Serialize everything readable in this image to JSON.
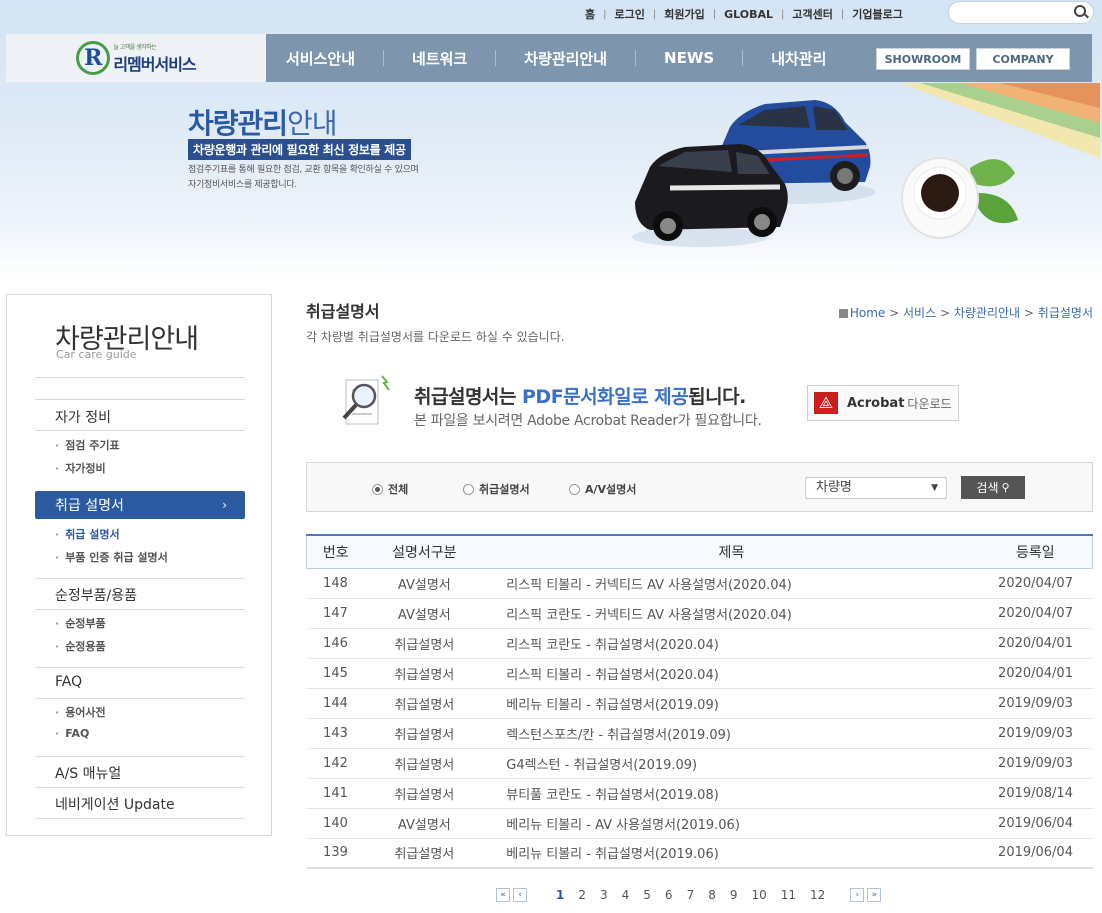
{
  "util": {
    "links": [
      "홈",
      "로그인",
      "회원가입",
      "GLOBAL",
      "고객센터",
      "기업블로그"
    ]
  },
  "nav": {
    "logo_small": "늘 고객을 생각하는",
    "logo_main": "리멤버서비스",
    "logo_letter": "R",
    "menu": [
      "서비스안내",
      "네트워크",
      "차량관리안내",
      "NEWS",
      "내차관리"
    ],
    "buttons": [
      "SHOWROOM",
      "COMPANY"
    ]
  },
  "banner": {
    "title_strong": "차량관리",
    "title_rest": "안내",
    "subtitle": "차량운행과 관리에 필요한 최신 정보를 제공",
    "desc_line1": "점검주기표를 통해 필요한 점검, 교환 항목을 확인하실 수 있으며",
    "desc_line2": "자기정비서비스를 제공합니다."
  },
  "sidebar": {
    "title": "차량관리안내",
    "subtitle": "Car care guide",
    "sections": {
      "self": "자가 정비",
      "self_links": [
        "점검 주기표",
        "자가정비"
      ],
      "manual": "취급 설명서",
      "manual_links": [
        "취급 설명서",
        "부품 인증 취급 설명서"
      ],
      "parts": "순정부품/용품",
      "parts_links": [
        "순정부품",
        "순정용품"
      ],
      "faq": "FAQ",
      "faq_links": [
        "용어사전",
        "FAQ"
      ],
      "as": "A/S 매뉴얼",
      "navi": "네비게이션 Update"
    }
  },
  "main": {
    "title": "취급설명서",
    "desc": "각 차량별 취급설명서를 다운로드 하실 수 있습니다.",
    "breadcrumb": [
      "Home",
      "서비스",
      "차량관리안내",
      "취급설명서"
    ],
    "pdf_title_a": "취급설명서는 ",
    "pdf_title_b": "PDF문서화일로 제공",
    "pdf_title_c": "됩니다.",
    "pdf_sub": "본 파일을 보시려면 Adobe Acrobat Reader가 필요합니다.",
    "acrobat_label": "Acrobat",
    "acrobat_download": "다운로드"
  },
  "filter": {
    "radios": [
      "전체",
      "취급설명서",
      "A/V설명서"
    ],
    "select_value": "차량명",
    "search_label": "검색"
  },
  "table": {
    "headers": [
      "번호",
      "설명서구분",
      "제목",
      "등록일"
    ],
    "rows": [
      [
        "148",
        "AV설명서",
        "리스픽 티볼리 - 커넥티드 AV 사용설명서(2020.04)",
        "2020/04/07"
      ],
      [
        "147",
        "AV설명서",
        "리스픽 코란도 - 커넥티드 AV 사용설명서(2020.04)",
        "2020/04/07"
      ],
      [
        "146",
        "취급설명서",
        "리스픽 코란도 - 취급설명서(2020.04)",
        "2020/04/01"
      ],
      [
        "145",
        "취급설명서",
        "리스픽 티볼리 - 취급설명서(2020.04)",
        "2020/04/01"
      ],
      [
        "144",
        "취급설명서",
        "베리뉴 티볼리 - 취급설명서(2019.09)",
        "2019/09/03"
      ],
      [
        "143",
        "취급설명서",
        "렉스턴스포츠/칸 - 취급설명서(2019.09)",
        "2019/09/03"
      ],
      [
        "142",
        "취급설명서",
        "G4렉스턴 - 취급설명서(2019.09)",
        "2019/09/03"
      ],
      [
        "141",
        "취급설명서",
        "뷰티풀 코란도 - 취급설명서(2019.08)",
        "2019/08/14"
      ],
      [
        "140",
        "AV설명서",
        "베리뉴 티볼리 - AV 사용설명서(2019.06)",
        "2019/06/04"
      ],
      [
        "139",
        "취급설명서",
        "베리뉴 티볼리 - 취급설명서(2019.06)",
        "2019/06/04"
      ]
    ]
  },
  "pager": {
    "pages": [
      "1",
      "2",
      "3",
      "4",
      "5",
      "6",
      "7",
      "8",
      "9",
      "10",
      "11",
      "12"
    ],
    "current": "1"
  }
}
